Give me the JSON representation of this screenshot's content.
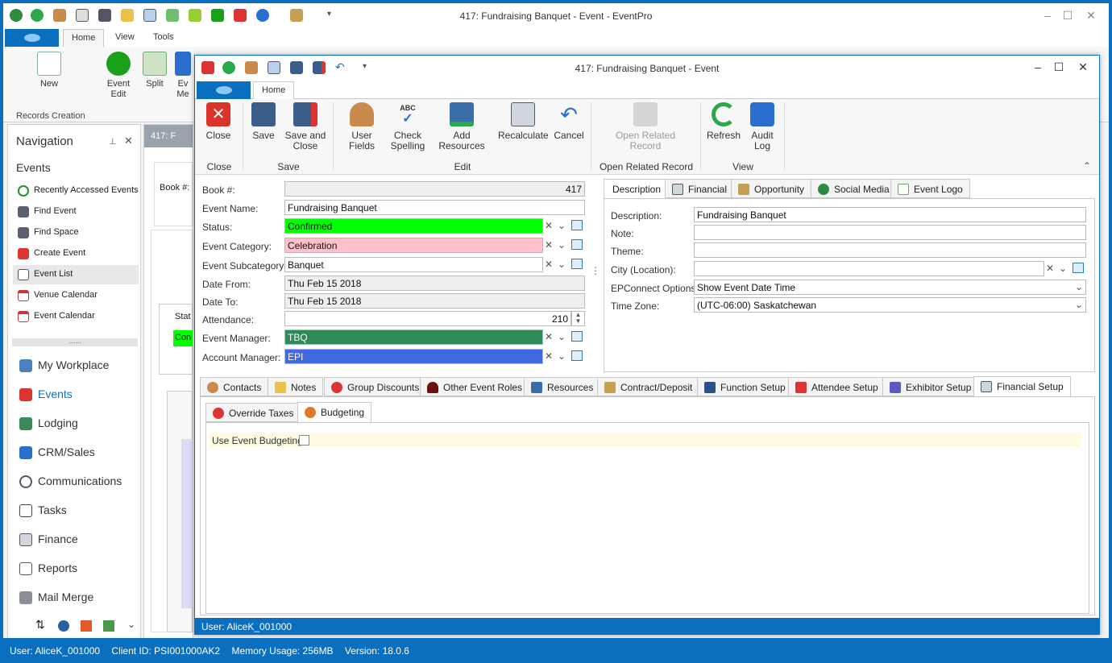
{
  "app": {
    "title": "417: Fundraising Banquet - Event - EventPro",
    "tabs": [
      "Home",
      "View",
      "Tools"
    ]
  },
  "main_ribbon": {
    "new_label": "New",
    "event_edit_label": "Event Edit",
    "split_label": "Split",
    "ev_label": "Ev Me",
    "group_label": "Records Creation"
  },
  "navigation": {
    "title": "Navigation",
    "section": "Events",
    "items": [
      {
        "label": "Recently Accessed Events",
        "icon": "clock-icon"
      },
      {
        "label": "Find Event",
        "icon": "binoculars-icon"
      },
      {
        "label": "Find Space",
        "icon": "binoculars-icon"
      },
      {
        "label": "Create Event",
        "icon": "pushpin-icon"
      },
      {
        "label": "Event List",
        "icon": "list-icon"
      },
      {
        "label": "Venue Calendar",
        "icon": "calendar-icon"
      },
      {
        "label": "Event Calendar",
        "icon": "calendar-icon"
      }
    ],
    "modules": [
      {
        "label": "My Workplace",
        "icon": "house-icon"
      },
      {
        "label": "Events",
        "icon": "pushpin-icon"
      },
      {
        "label": "Lodging",
        "icon": "bed-icon"
      },
      {
        "label": "CRM/Sales",
        "icon": "people-icon"
      },
      {
        "label": "Communications",
        "icon": "speech-bubble-icon"
      },
      {
        "label": "Tasks",
        "icon": "clipboard-icon"
      },
      {
        "label": "Finance",
        "icon": "calculator-icon"
      },
      {
        "label": "Reports",
        "icon": "report-icon"
      },
      {
        "label": "Mail Merge",
        "icon": "mail-merge-icon"
      }
    ],
    "splitter": "......"
  },
  "bg_strip": {
    "tab_label": "417: F",
    "book_label": "Book #:",
    "status_head": "Stat",
    "cell1": "Con"
  },
  "child": {
    "title": "417: Fundraising Banquet - Event",
    "tab": "Home",
    "ribbon": {
      "close": "Close",
      "save": "Save",
      "save_close": "Save and Close",
      "user_fields": "User Fields",
      "check_spelling": "Check Spelling",
      "add_resources": "Add Resources",
      "recalculate": "Recalculate",
      "cancel": "Cancel",
      "open_related": "Open Related Record",
      "refresh": "Refresh",
      "audit_log": "Audit Log",
      "groups": {
        "close": "Close",
        "save": "Save",
        "edit": "Edit",
        "open_related": "Open Related Record",
        "view": "View"
      }
    },
    "form": {
      "book_label": "Book #:",
      "book_value": "417",
      "name_label": "Event Name:",
      "name_value": "Fundraising Banquet",
      "status_label": "Status:",
      "status_value": "Confirmed",
      "status_color": "#00ff00",
      "category_label": "Event Category:",
      "category_value": "Celebration",
      "category_color": "#ffc0cb",
      "subcategory_label": "Event Subcategory:",
      "subcategory_value": "Banquet",
      "date_from_label": "Date From:",
      "date_from_value": "Thu Feb 15 2018",
      "date_to_label": "Date To:",
      "date_to_value": "Thu Feb 15 2018",
      "attendance_label": "Attendance:",
      "attendance_value": "210",
      "manager_label": "Event Manager:",
      "manager_value": "TBQ",
      "manager_color": "#2e8b57",
      "account_label": "Account Manager:",
      "account_value": "EPI",
      "account_color": "#4169e1"
    },
    "right_tabs": [
      "Description",
      "Financial",
      "Opportunity",
      "Social Media",
      "Event Logo"
    ],
    "description": {
      "desc_label": "Description:",
      "desc_value": "Fundraising Banquet",
      "note_label": "Note:",
      "theme_label": "Theme:",
      "city_label": "City (Location):",
      "epconnect_label": "EPConnect Options:",
      "epconnect_value": "Show Event Date Time",
      "tz_label": "Time Zone:",
      "tz_value": "(UTC-06:00) Saskatchewan"
    },
    "bottom_tabs": [
      "Contacts",
      "Notes",
      "Group Discounts",
      "Other Event Roles",
      "Resources",
      "Contract/Deposit",
      "Function Setup",
      "Attendee Setup",
      "Exhibitor Setup",
      "Financial Setup"
    ],
    "sub_tabs": [
      "Override Taxes",
      "Budgeting"
    ],
    "budget_label": "Use Event Budgeting",
    "status_user": "User: AliceK_001000"
  },
  "main_status": {
    "user": "User: AliceK_001000",
    "client": "Client ID: PSI001000AK2",
    "memory": "Memory Usage: 256MB",
    "version": "Version: 18.0.6"
  }
}
